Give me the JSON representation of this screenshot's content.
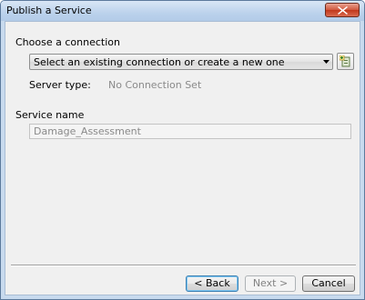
{
  "window": {
    "title": "Publish a Service"
  },
  "connection": {
    "section_label": "Choose a connection",
    "combo_value": "Select an existing connection or create a new one",
    "server_type_label": "Server type:",
    "server_type_value": "No Connection Set"
  },
  "service": {
    "section_label": "Service name",
    "name_value": "Damage_Assessment"
  },
  "buttons": {
    "back": "< Back",
    "next": "Next >",
    "cancel": "Cancel"
  },
  "icons": {
    "close": "close-icon",
    "dropdown": "chevron-down-icon",
    "add_connection": "add-server-icon"
  }
}
